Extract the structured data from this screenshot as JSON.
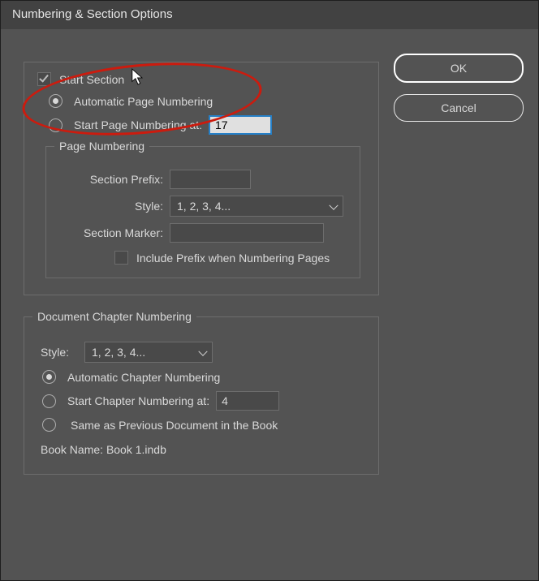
{
  "title": "Numbering & Section Options",
  "buttons": {
    "ok": "OK",
    "cancel": "Cancel"
  },
  "start_section": {
    "label": "Start Section",
    "checked": true
  },
  "page_numbering_mode": {
    "automatic_label": "Automatic Page Numbering",
    "start_at_label": "Start Page Numbering at:",
    "start_at_value": "17",
    "selected": "automatic"
  },
  "page_numbering": {
    "legend": "Page Numbering",
    "section_prefix_label": "Section Prefix:",
    "section_prefix_value": "",
    "style_label": "Style:",
    "style_value": "1, 2, 3, 4...",
    "section_marker_label": "Section Marker:",
    "section_marker_value": "",
    "include_prefix_label": "Include Prefix when Numbering Pages",
    "include_prefix_checked": false
  },
  "chapter": {
    "legend": "Document Chapter Numbering",
    "style_label": "Style:",
    "style_value": "1, 2, 3, 4...",
    "automatic_label": "Automatic Chapter Numbering",
    "start_at_label": "Start Chapter Numbering at:",
    "start_at_value": "4",
    "same_as_prev_label": "Same as Previous Document in the Book",
    "selected": "automatic",
    "book_name_label": "Book Name:",
    "book_name_value": "Book 1.indb"
  }
}
